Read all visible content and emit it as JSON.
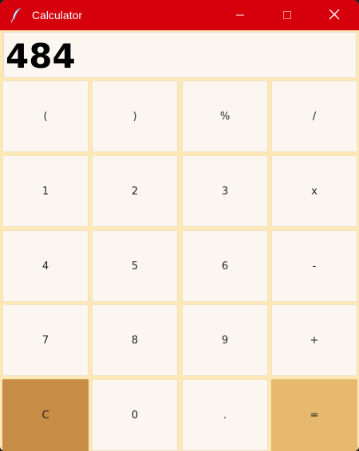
{
  "window": {
    "title": "Calculator",
    "app_icon": "feather-icon",
    "controls": [
      "minimize-icon",
      "maximize-icon",
      "close-icon"
    ]
  },
  "display": {
    "value": "484"
  },
  "keypad": {
    "k_lparen": "(",
    "k_rparen": ")",
    "k_percent": "%",
    "k_divide": "/",
    "k_1": "1",
    "k_2": "2",
    "k_3": "3",
    "k_multiply": "x",
    "k_4": "4",
    "k_5": "5",
    "k_6": "6",
    "k_minus": "-",
    "k_7": "7",
    "k_8": "8",
    "k_9": "9",
    "k_plus": "+",
    "k_clear": "C",
    "k_0": "0",
    "k_dot": ".",
    "k_equals": "="
  },
  "colors": {
    "titlebar": "#d6000d",
    "key_background": "#fbf7f0",
    "grid_background": "#fde8b6",
    "clear_key": "#c78c46",
    "equals_key": "#e6b96e"
  }
}
